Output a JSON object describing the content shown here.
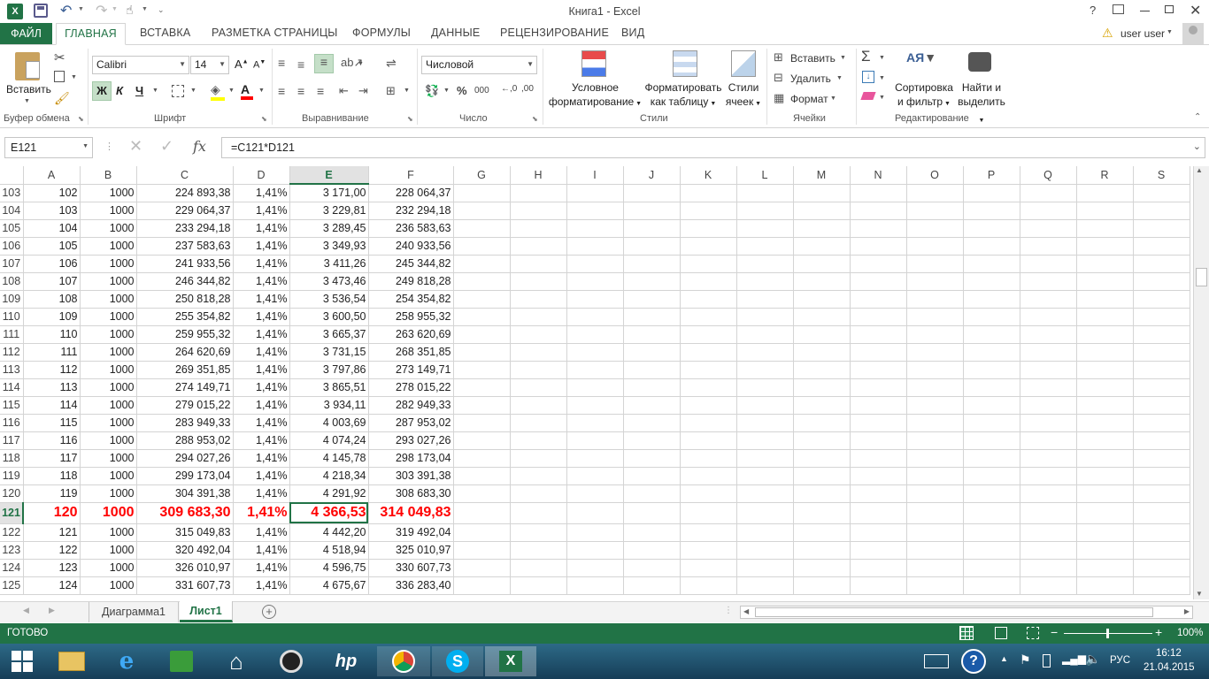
{
  "window": {
    "title": "Книга1 - Excel",
    "user": "user user"
  },
  "ribbon_tabs": [
    "ФАЙЛ",
    "ГЛАВНАЯ",
    "ВСТАВКА",
    "РАЗМЕТКА СТРАНИЦЫ",
    "ФОРМУЛЫ",
    "ДАННЫЕ",
    "РЕЦЕНЗИРОВАНИЕ",
    "ВИД"
  ],
  "ribbon": {
    "clipboard": {
      "paste": "Вставить",
      "group": "Буфер обмена"
    },
    "font": {
      "name": "Calibri",
      "size": "14",
      "bold": "Ж",
      "italic": "К",
      "underline": "Ч",
      "group": "Шрифт"
    },
    "alignment": {
      "group": "Выравнивание"
    },
    "number": {
      "format": "Числовой",
      "percent": "%",
      "thousands": "000",
      "group": "Число"
    },
    "styles": {
      "conditional1": "Условное",
      "conditional2": "форматирование",
      "table1": "Форматировать",
      "table2": "как таблицу",
      "cell1": "Стили",
      "cell2": "ячеек",
      "group": "Стили"
    },
    "cells": {
      "insert": "Вставить",
      "delete": "Удалить",
      "format": "Формат",
      "group": "Ячейки"
    },
    "editing": {
      "sort1": "Сортировка",
      "sort2": "и фильтр",
      "find1": "Найти и",
      "find2": "выделить",
      "group": "Редактирование"
    }
  },
  "formula_bar": {
    "name_box": "E121",
    "formula": "=C121*D121",
    "fx": "fx"
  },
  "columns": [
    "A",
    "B",
    "C",
    "D",
    "E",
    "F",
    "G",
    "H",
    "I",
    "J",
    "K",
    "L",
    "M",
    "N",
    "O",
    "P",
    "Q",
    "R",
    "S"
  ],
  "active_cell": {
    "column": "E",
    "row": "121"
  },
  "rows": [
    {
      "n": "103",
      "a": "102",
      "b": "1000",
      "c": "224 893,38",
      "d": "1,41%",
      "e": "3 171,00",
      "f": "228 064,37"
    },
    {
      "n": "104",
      "a": "103",
      "b": "1000",
      "c": "229 064,37",
      "d": "1,41%",
      "e": "3 229,81",
      "f": "232 294,18"
    },
    {
      "n": "105",
      "a": "104",
      "b": "1000",
      "c": "233 294,18",
      "d": "1,41%",
      "e": "3 289,45",
      "f": "236 583,63"
    },
    {
      "n": "106",
      "a": "105",
      "b": "1000",
      "c": "237 583,63",
      "d": "1,41%",
      "e": "3 349,93",
      "f": "240 933,56"
    },
    {
      "n": "107",
      "a": "106",
      "b": "1000",
      "c": "241 933,56",
      "d": "1,41%",
      "e": "3 411,26",
      "f": "245 344,82"
    },
    {
      "n": "108",
      "a": "107",
      "b": "1000",
      "c": "246 344,82",
      "d": "1,41%",
      "e": "3 473,46",
      "f": "249 818,28"
    },
    {
      "n": "109",
      "a": "108",
      "b": "1000",
      "c": "250 818,28",
      "d": "1,41%",
      "e": "3 536,54",
      "f": "254 354,82"
    },
    {
      "n": "110",
      "a": "109",
      "b": "1000",
      "c": "255 354,82",
      "d": "1,41%",
      "e": "3 600,50",
      "f": "258 955,32"
    },
    {
      "n": "111",
      "a": "110",
      "b": "1000",
      "c": "259 955,32",
      "d": "1,41%",
      "e": "3 665,37",
      "f": "263 620,69"
    },
    {
      "n": "112",
      "a": "111",
      "b": "1000",
      "c": "264 620,69",
      "d": "1,41%",
      "e": "3 731,15",
      "f": "268 351,85"
    },
    {
      "n": "113",
      "a": "112",
      "b": "1000",
      "c": "269 351,85",
      "d": "1,41%",
      "e": "3 797,86",
      "f": "273 149,71"
    },
    {
      "n": "114",
      "a": "113",
      "b": "1000",
      "c": "274 149,71",
      "d": "1,41%",
      "e": "3 865,51",
      "f": "278 015,22"
    },
    {
      "n": "115",
      "a": "114",
      "b": "1000",
      "c": "279 015,22",
      "d": "1,41%",
      "e": "3 934,11",
      "f": "282 949,33"
    },
    {
      "n": "116",
      "a": "115",
      "b": "1000",
      "c": "283 949,33",
      "d": "1,41%",
      "e": "4 003,69",
      "f": "287 953,02"
    },
    {
      "n": "117",
      "a": "116",
      "b": "1000",
      "c": "288 953,02",
      "d": "1,41%",
      "e": "4 074,24",
      "f": "293 027,26"
    },
    {
      "n": "118",
      "a": "117",
      "b": "1000",
      "c": "294 027,26",
      "d": "1,41%",
      "e": "4 145,78",
      "f": "298 173,04"
    },
    {
      "n": "119",
      "a": "118",
      "b": "1000",
      "c": "299 173,04",
      "d": "1,41%",
      "e": "4 218,34",
      "f": "303 391,38"
    },
    {
      "n": "120",
      "a": "119",
      "b": "1000",
      "c": "304 391,38",
      "d": "1,41%",
      "e": "4 291,92",
      "f": "308 683,30"
    },
    {
      "n": "121",
      "a": "120",
      "b": "1000",
      "c": "309 683,30",
      "d": "1,41%",
      "e": "4 366,53",
      "f": "314 049,83",
      "highlight": true
    },
    {
      "n": "122",
      "a": "121",
      "b": "1000",
      "c": "315 049,83",
      "d": "1,41%",
      "e": "4 442,20",
      "f": "319 492,04"
    },
    {
      "n": "123",
      "a": "122",
      "b": "1000",
      "c": "320 492,04",
      "d": "1,41%",
      "e": "4 518,94",
      "f": "325 010,97"
    },
    {
      "n": "124",
      "a": "123",
      "b": "1000",
      "c": "326 010,97",
      "d": "1,41%",
      "e": "4 596,75",
      "f": "330 607,73"
    },
    {
      "n": "125",
      "a": "124",
      "b": "1000",
      "c": "331 607,73",
      "d": "1,41%",
      "e": "4 675,67",
      "f": "336 283,40"
    }
  ],
  "sheet_tabs": [
    "Диаграмма1",
    "Лист1"
  ],
  "active_sheet": "Лист1",
  "status": {
    "ready": "ГОТОВО",
    "zoom": "100%"
  },
  "taskbar": {
    "lang": "РУС",
    "time": "16:12",
    "date": "21.04.2015"
  },
  "colors": {
    "excel_green": "#217346",
    "highlight_red": "#ff0000"
  }
}
